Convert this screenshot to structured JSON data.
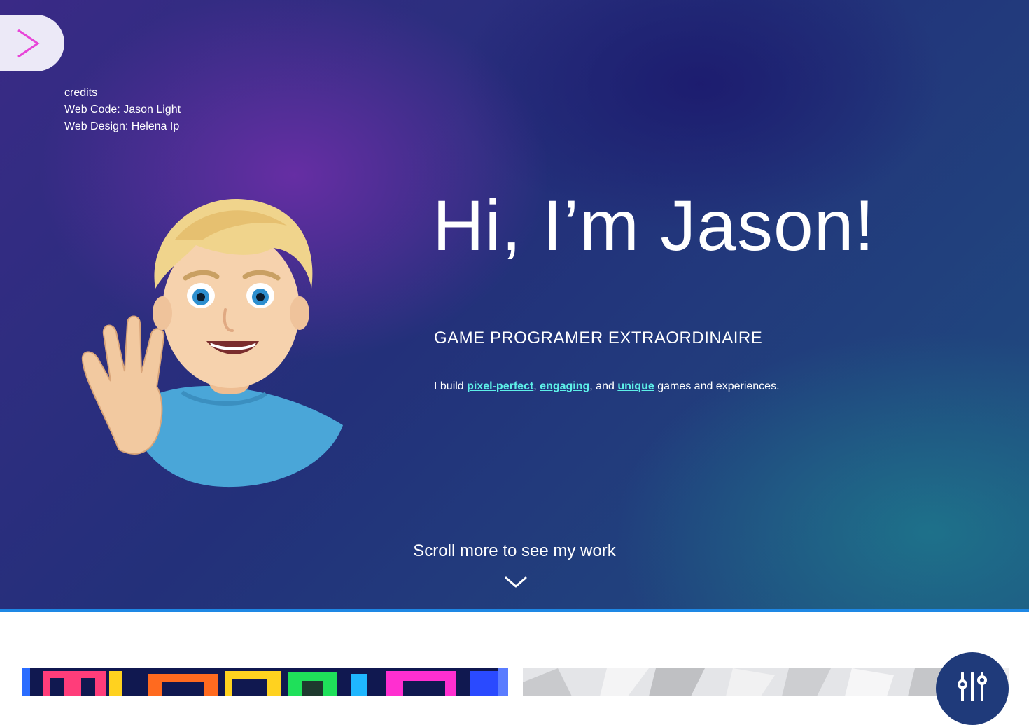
{
  "nav": {
    "menu_icon": "chevron-right-icon"
  },
  "credits": {
    "heading": "credits",
    "web_code": "Web Code: Jason Light",
    "web_design": "Web Design: Helena Ip"
  },
  "hero": {
    "title": "Hi, I’m Jason!",
    "subtitle": "GAME PROGRAMER EXTRAORDINAIRE",
    "tagline_prefix": "I build ",
    "tagline_link_1": "pixel-perfect",
    "tagline_sep_1": ", ",
    "tagline_link_2": "engaging",
    "tagline_sep_2": ", and ",
    "tagline_link_3": "unique",
    "tagline_suffix": " games and experiences.",
    "scroll_hint": "Scroll more to see my work",
    "scroll_icon": "chevron-down-icon",
    "avatar_icon": "waving-boy-avatar"
  },
  "work": {
    "cards": [
      {
        "name": "tetris-project-thumbnail"
      },
      {
        "name": "abstract-project-thumbnail"
      }
    ]
  },
  "settings": {
    "icon": "sliders-icon"
  },
  "colors": {
    "menu_chevron": "#e844d8",
    "link": "#5df0e8",
    "divider": "#1e88e5",
    "fab": "#1f3a7a"
  }
}
